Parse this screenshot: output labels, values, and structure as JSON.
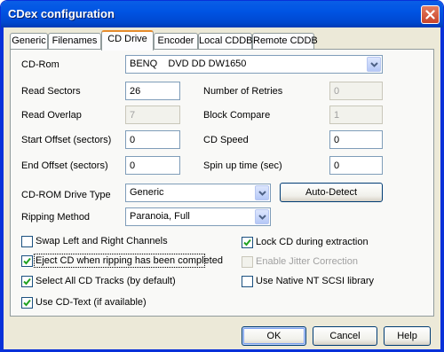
{
  "window": {
    "title": "CDex configuration"
  },
  "tabs": [
    {
      "label": "Generic"
    },
    {
      "label": "Filenames"
    },
    {
      "label": "CD Drive"
    },
    {
      "label": "Encoder"
    },
    {
      "label": "Local CDDB"
    },
    {
      "label": "Remote CDDB"
    }
  ],
  "active_tab": "CD Drive",
  "cd_rom": {
    "label": "CD-Rom",
    "value": "BENQ    DVD DD DW1650"
  },
  "read_sectors": {
    "label": "Read Sectors",
    "value": "26"
  },
  "read_overlap": {
    "label": "Read Overlap",
    "value": "7"
  },
  "start_offset": {
    "label": "Start Offset (sectors)",
    "value": "0"
  },
  "end_offset": {
    "label": "End Offset (sectors)",
    "value": "0"
  },
  "number_of_retries": {
    "label": "Number of Retries",
    "value": "0"
  },
  "block_compare": {
    "label": "Block Compare",
    "value": "1"
  },
  "cd_speed": {
    "label": "CD Speed",
    "value": "0"
  },
  "spin_up_time": {
    "label": "Spin up time (sec)",
    "value": "0"
  },
  "drive_type": {
    "label": "CD-ROM Drive Type",
    "value": "Generic"
  },
  "auto_detect": {
    "label": "Auto-Detect"
  },
  "ripping_method": {
    "label": "Ripping Method",
    "value": "Paranoia, Full"
  },
  "checkboxes": {
    "swap_channels": {
      "label": "Swap Left and Right Channels",
      "checked": false
    },
    "eject_cd": {
      "label": "Eject CD when ripping has been completed",
      "checked": true
    },
    "select_all_tracks": {
      "label": "Select All CD Tracks (by default)",
      "checked": true
    },
    "use_cd_text": {
      "label": "Use CD-Text (if available)",
      "checked": true
    },
    "lock_cd": {
      "label": "Lock CD during extraction",
      "checked": true
    },
    "jitter_correction": {
      "label": "Enable Jitter Correction",
      "checked": false,
      "disabled": true
    },
    "native_scsi": {
      "label": "Use Native NT SCSI library",
      "checked": false
    }
  },
  "buttons": {
    "ok": "OK",
    "cancel": "Cancel",
    "help": "Help"
  },
  "colors": {
    "titlebar": "#0054e3",
    "dialog_bg": "#ece9d8",
    "active_tab_accent": "#e68b2c",
    "check": "#21a121"
  },
  "icons": {
    "close": "close-icon",
    "dropdown": "chevron-down-icon",
    "check": "checkmark-icon"
  }
}
